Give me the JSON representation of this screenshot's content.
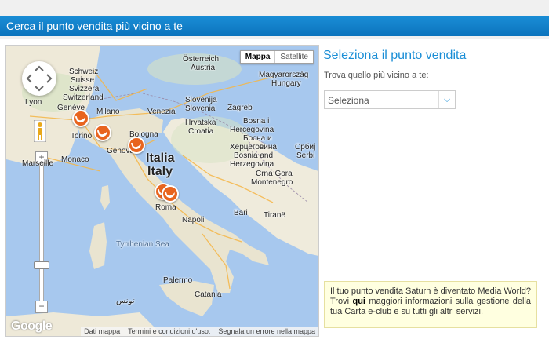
{
  "header": {
    "title": "Cerca il punto vendita più vicino a te"
  },
  "map": {
    "type_mappa": "Mappa",
    "type_satellite": "Satellite",
    "zoom_plus": "+",
    "zoom_minus": "−",
    "logo": "Google",
    "footer": {
      "data": "Dati mappa",
      "terms": "Termini e condizioni d'uso.",
      "report": "Segnala un errore nella mappa"
    },
    "labels": {
      "osterreich": "Österreich",
      "austria": "Austria",
      "schweiz": "Schweiz",
      "suisse": "Suisse",
      "svizzera": "Svizzera",
      "switzerland": "Switzerland",
      "magyarorszag": "Magyarország",
      "hungary": "Hungary",
      "lyon": "Lyon",
      "geneve": "Genève",
      "milano": "Milano",
      "venezia": "Venezia",
      "slovenija": "Slovenija",
      "slovenia": "Slovenia",
      "zagreb": "Zagreb",
      "torino": "Torino",
      "hrvatska": "Hrvatska",
      "croatia": "Croatia",
      "bosna_i": "Bosna i",
      "hercegovina": "Hercegovina",
      "bosna_cyr": "Босна и",
      "hercegovina_cyr": "Херцеговина",
      "bosnia_and": "Bosnia and",
      "herzegovina": "Herzegovina",
      "srbija": "Србиј",
      "serbia": "Serbi",
      "genova": "Genova",
      "bologna": "Bologna",
      "monaco": "Monaco",
      "marseille": "Marseille",
      "italia": "Italia",
      "italy": "Italy",
      "crna_gora": "Crna Gora",
      "montenegro": "Montenegro",
      "roma": "Roma",
      "bari": "Bari",
      "tirane": "Tiranë",
      "napoli": "Napoli",
      "tyrrhenian": "Tyrrhenian Sea",
      "palermo": "Palermo",
      "catania": "Catania",
      "tunisia": "تونس"
    }
  },
  "side": {
    "title": "Seleziona il punto vendita",
    "subtitle": "Trova quello più vicino a te:",
    "select_value": "Seleziona",
    "notice_before": "Il tuo punto vendita Saturn è diventato Media World? Trovi ",
    "notice_link": "qui",
    "notice_after": " maggiori informazioni sulla gestione della tua Carta e-club e su tutti gli altri servizi."
  },
  "colors": {
    "accent": "#1a8ed6",
    "marker": "#e8641e",
    "sea": "#a7c8ee",
    "land": "#f1ecdf"
  }
}
